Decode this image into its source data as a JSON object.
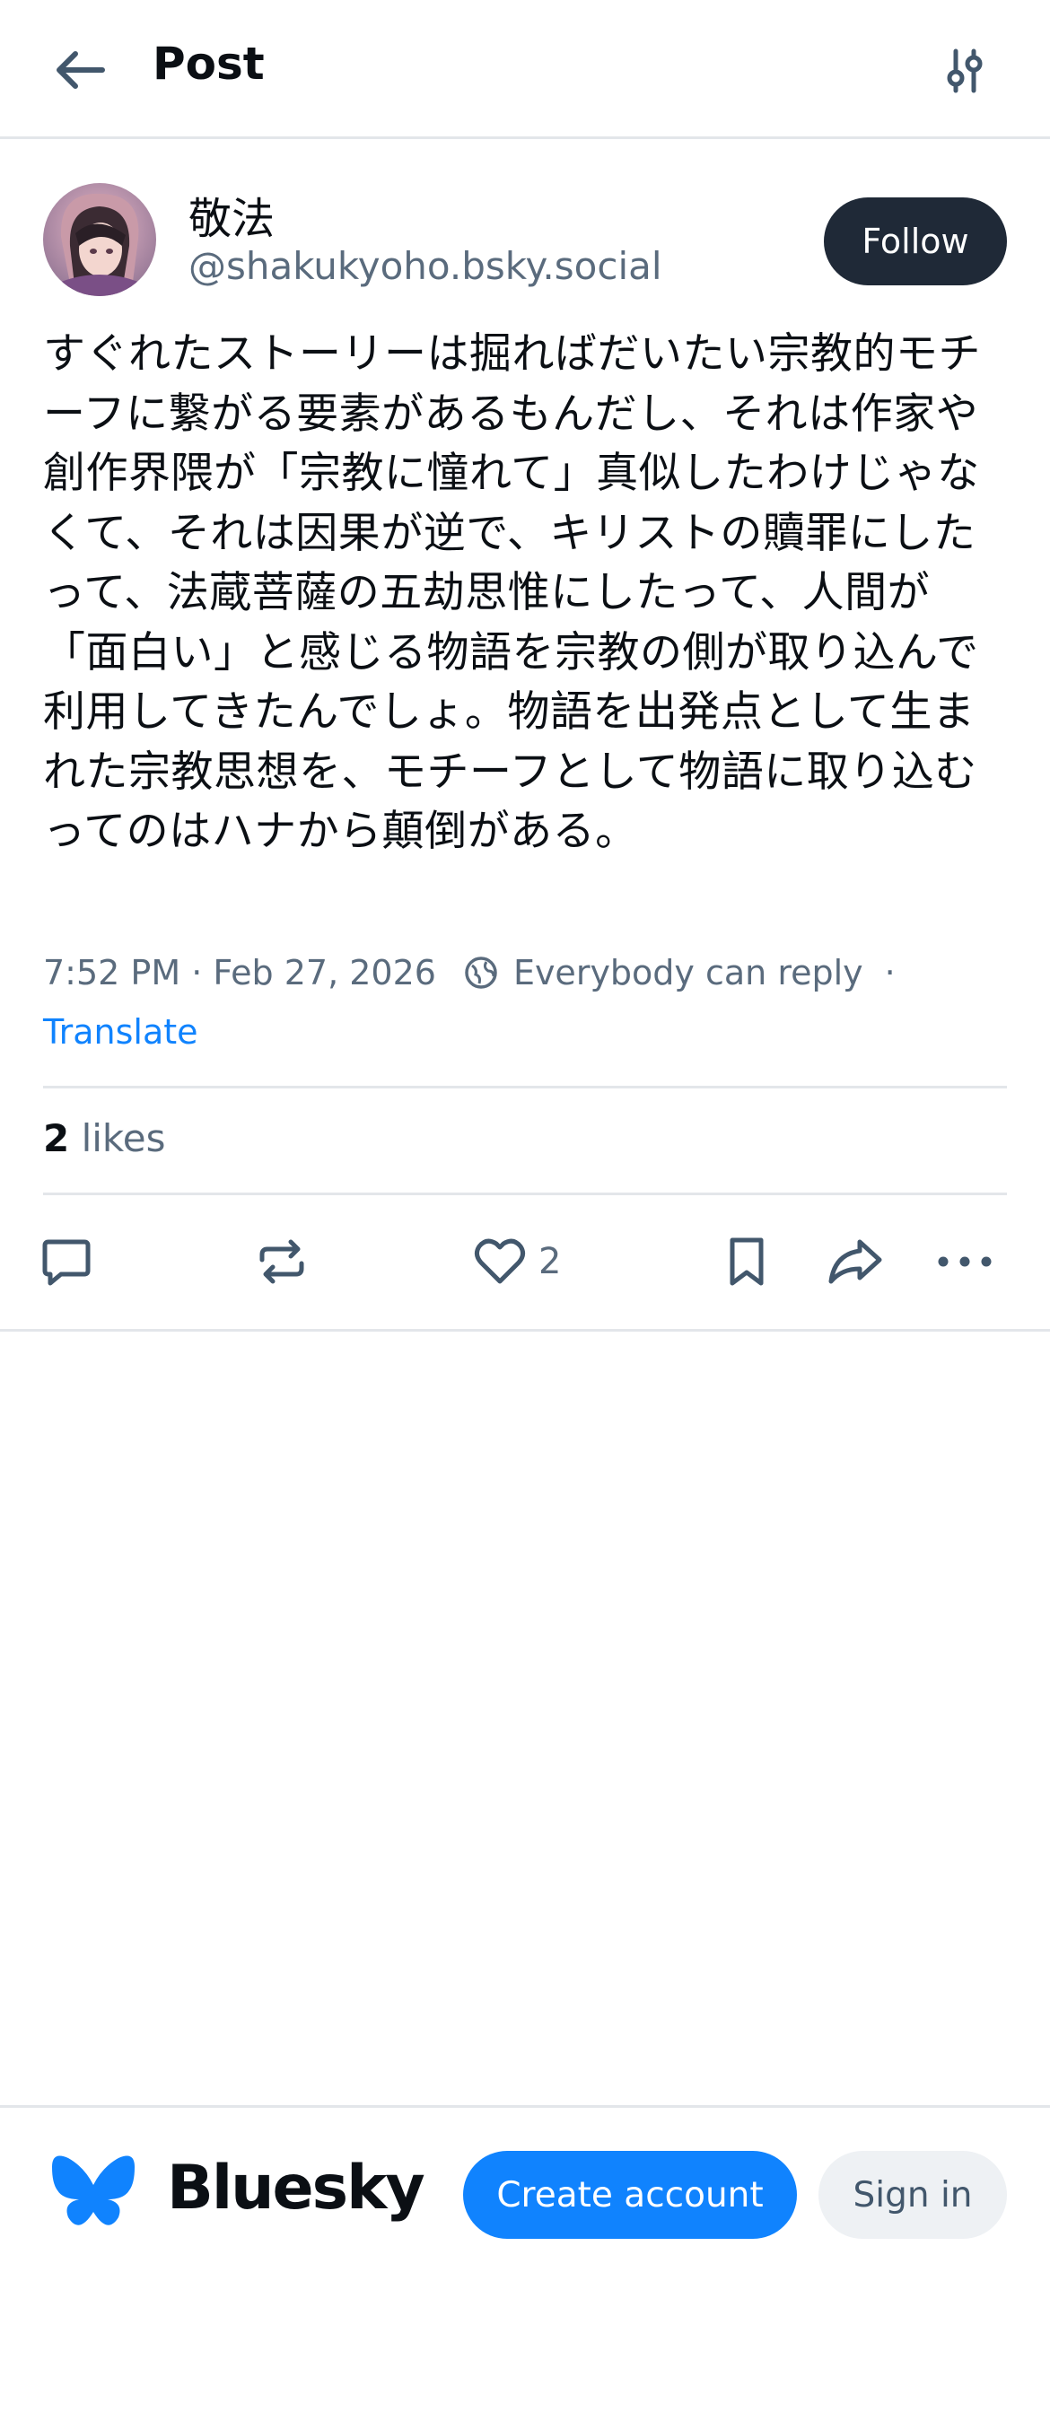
{
  "header": {
    "title": "Post",
    "back_icon": "arrow-left-icon",
    "filter_icon": "sliders-icon"
  },
  "author": {
    "display_name": "敬法",
    "handle": "@shakukyoho.bsky.social",
    "follow_label": "Follow"
  },
  "post": {
    "text": "すぐれたストーリーは掘ればだいたい宗教的モチーフに繋がる要素があるもんだし、それは作家や創作界隈が「宗教に憧れて」真似したわけじゃなくて、それは因果が逆で、キリストの贖罪にしたって、法蔵菩薩の五劫思惟にしたって、人間が「面白い」と感じる物語を宗教の側が取り込んで利用してきたんでしょ。物語を出発点として生まれた宗教思想を、モチーフとして物語に取り込むってのはハナから顛倒がある。",
    "timestamp": "7:52 PM · Feb 27, 2026",
    "reply_setting": "Everybody can reply",
    "separator": "·",
    "translate_label": "Translate"
  },
  "stats": {
    "likes_count": "2",
    "likes_label": "likes"
  },
  "actions": {
    "reply_icon": "speech-bubble-icon",
    "repost_icon": "repost-icon",
    "like_icon": "heart-icon",
    "like_count": "2",
    "bookmark_icon": "bookmark-icon",
    "share_icon": "share-arrow-icon",
    "more_icon": "ellipsis-icon"
  },
  "footer": {
    "brand": "Bluesky",
    "create_account_label": "Create account",
    "sign_in_label": "Sign in"
  },
  "colors": {
    "accent": "#1083fe",
    "follow_bg": "#1f2937",
    "muted_text": "#5a6b7d",
    "divider": "#e3e6ea"
  }
}
